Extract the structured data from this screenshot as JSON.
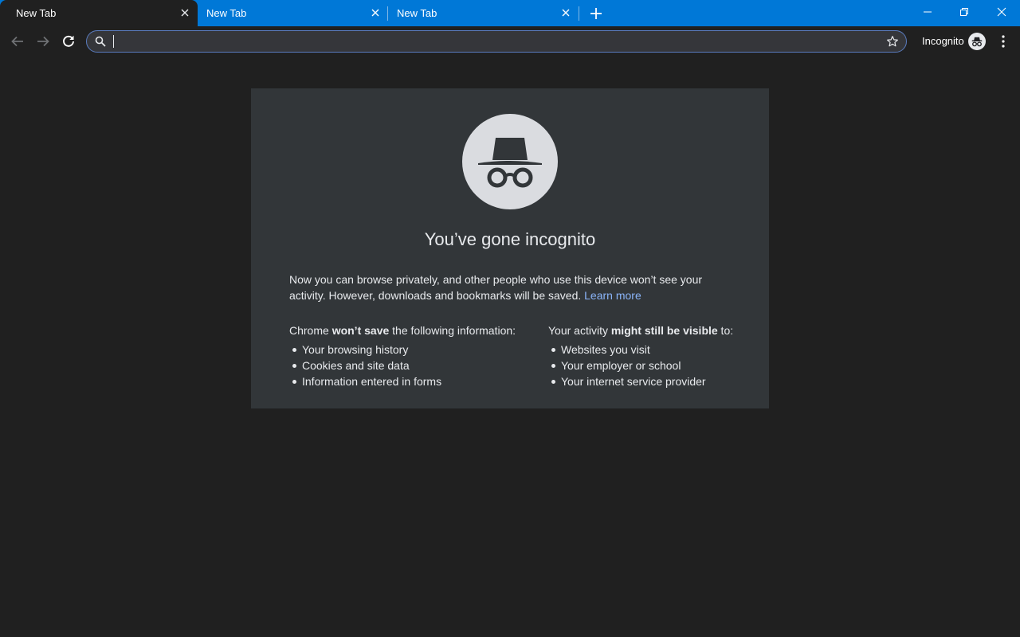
{
  "tabs": [
    {
      "title": "New Tab",
      "active": true
    },
    {
      "title": "New Tab",
      "active": false
    },
    {
      "title": "New Tab",
      "active": false
    }
  ],
  "toolbar": {
    "omnibox_value": "",
    "profile_label": "Incognito"
  },
  "icons": {
    "back": "arrow-back-icon",
    "forward": "arrow-forward-icon",
    "reload": "reload-icon",
    "search": "search-icon",
    "bookmark": "star-icon",
    "profile": "incognito-icon",
    "menu": "kebab-menu-icon",
    "new_tab": "plus-icon",
    "minimize": "minimize-icon",
    "restore": "restore-icon",
    "close": "close-icon"
  },
  "colors": {
    "tabstrip": "#0078d7",
    "background": "#202020",
    "card": "#323639",
    "link": "#8ab4f8"
  },
  "content": {
    "headline": "You’ve gone incognito",
    "intro": "Now you can browse privately, and other people who use this device won’t see your activity. However, downloads and bookmarks will be saved.",
    "learn_more": "Learn more",
    "left_column": {
      "title_pre": "Chrome ",
      "title_bold": "won’t save",
      "title_post": " the following information:",
      "items": [
        "Your browsing history",
        "Cookies and site data",
        "Information entered in forms"
      ]
    },
    "right_column": {
      "title_pre": "Your activity ",
      "title_bold": "might still be visible",
      "title_post": " to:",
      "items": [
        "Websites you visit",
        "Your employer or school",
        "Your internet service provider"
      ]
    }
  }
}
